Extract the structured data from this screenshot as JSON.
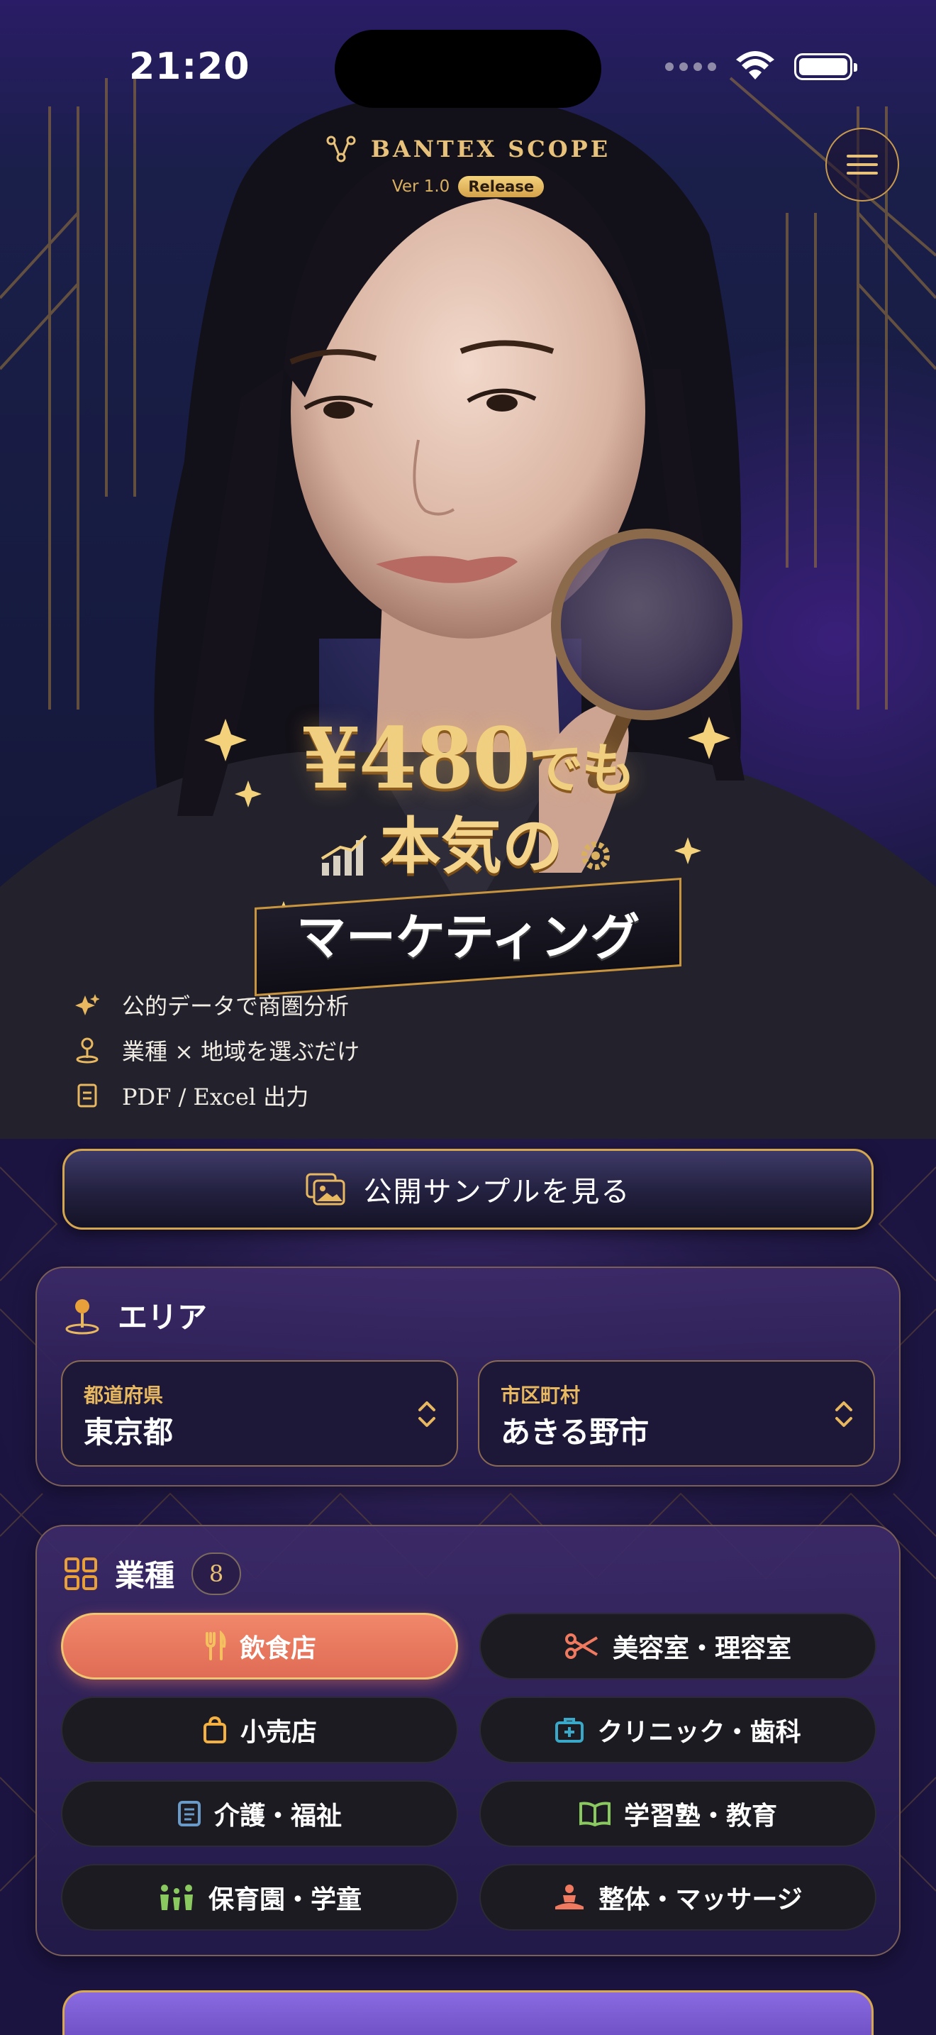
{
  "status_bar": {
    "time": "21:20"
  },
  "brand": {
    "name": "BANTEX SCOPE",
    "version": "Ver 1.0",
    "badge": "Release"
  },
  "hero": {
    "headline_price": "¥480",
    "headline_price_suffix": "でも",
    "headline_line2": "本気の",
    "headline_ribbon": "マーケティング",
    "features": [
      {
        "icon": "sparkle-icon",
        "text": "公的データで商圏分析"
      },
      {
        "icon": "map-pin-icon",
        "text": "業種 × 地域を選ぶだけ"
      },
      {
        "icon": "document-icon",
        "text": "PDF / Excel 出力"
      }
    ]
  },
  "sample_button": {
    "label": "公開サンプルを見る"
  },
  "area": {
    "title": "エリア",
    "prefecture": {
      "label": "都道府県",
      "value": "東京都"
    },
    "city": {
      "label": "市区町村",
      "value": "あきる野市"
    }
  },
  "industry": {
    "title": "業種",
    "count": "8",
    "items": [
      {
        "label": "飲食店",
        "icon": "fork-knife-icon",
        "active": true
      },
      {
        "label": "美容室・理容室",
        "icon": "scissors-icon",
        "active": false
      },
      {
        "label": "小売店",
        "icon": "shopping-bag-icon",
        "active": false
      },
      {
        "label": "クリニック・歯科",
        "icon": "medical-kit-icon",
        "active": false
      },
      {
        "label": "介護・福祉",
        "icon": "care-list-icon",
        "active": false
      },
      {
        "label": "学習塾・教育",
        "icon": "open-book-icon",
        "active": false
      },
      {
        "label": "保育園・学童",
        "icon": "people-icon",
        "active": false
      },
      {
        "label": "整体・マッサージ",
        "icon": "meditation-icon",
        "active": false
      }
    ]
  },
  "colors": {
    "gold": "#d4a64f",
    "active_chip": "#e8785e",
    "card_bg": "#2a1f55"
  }
}
